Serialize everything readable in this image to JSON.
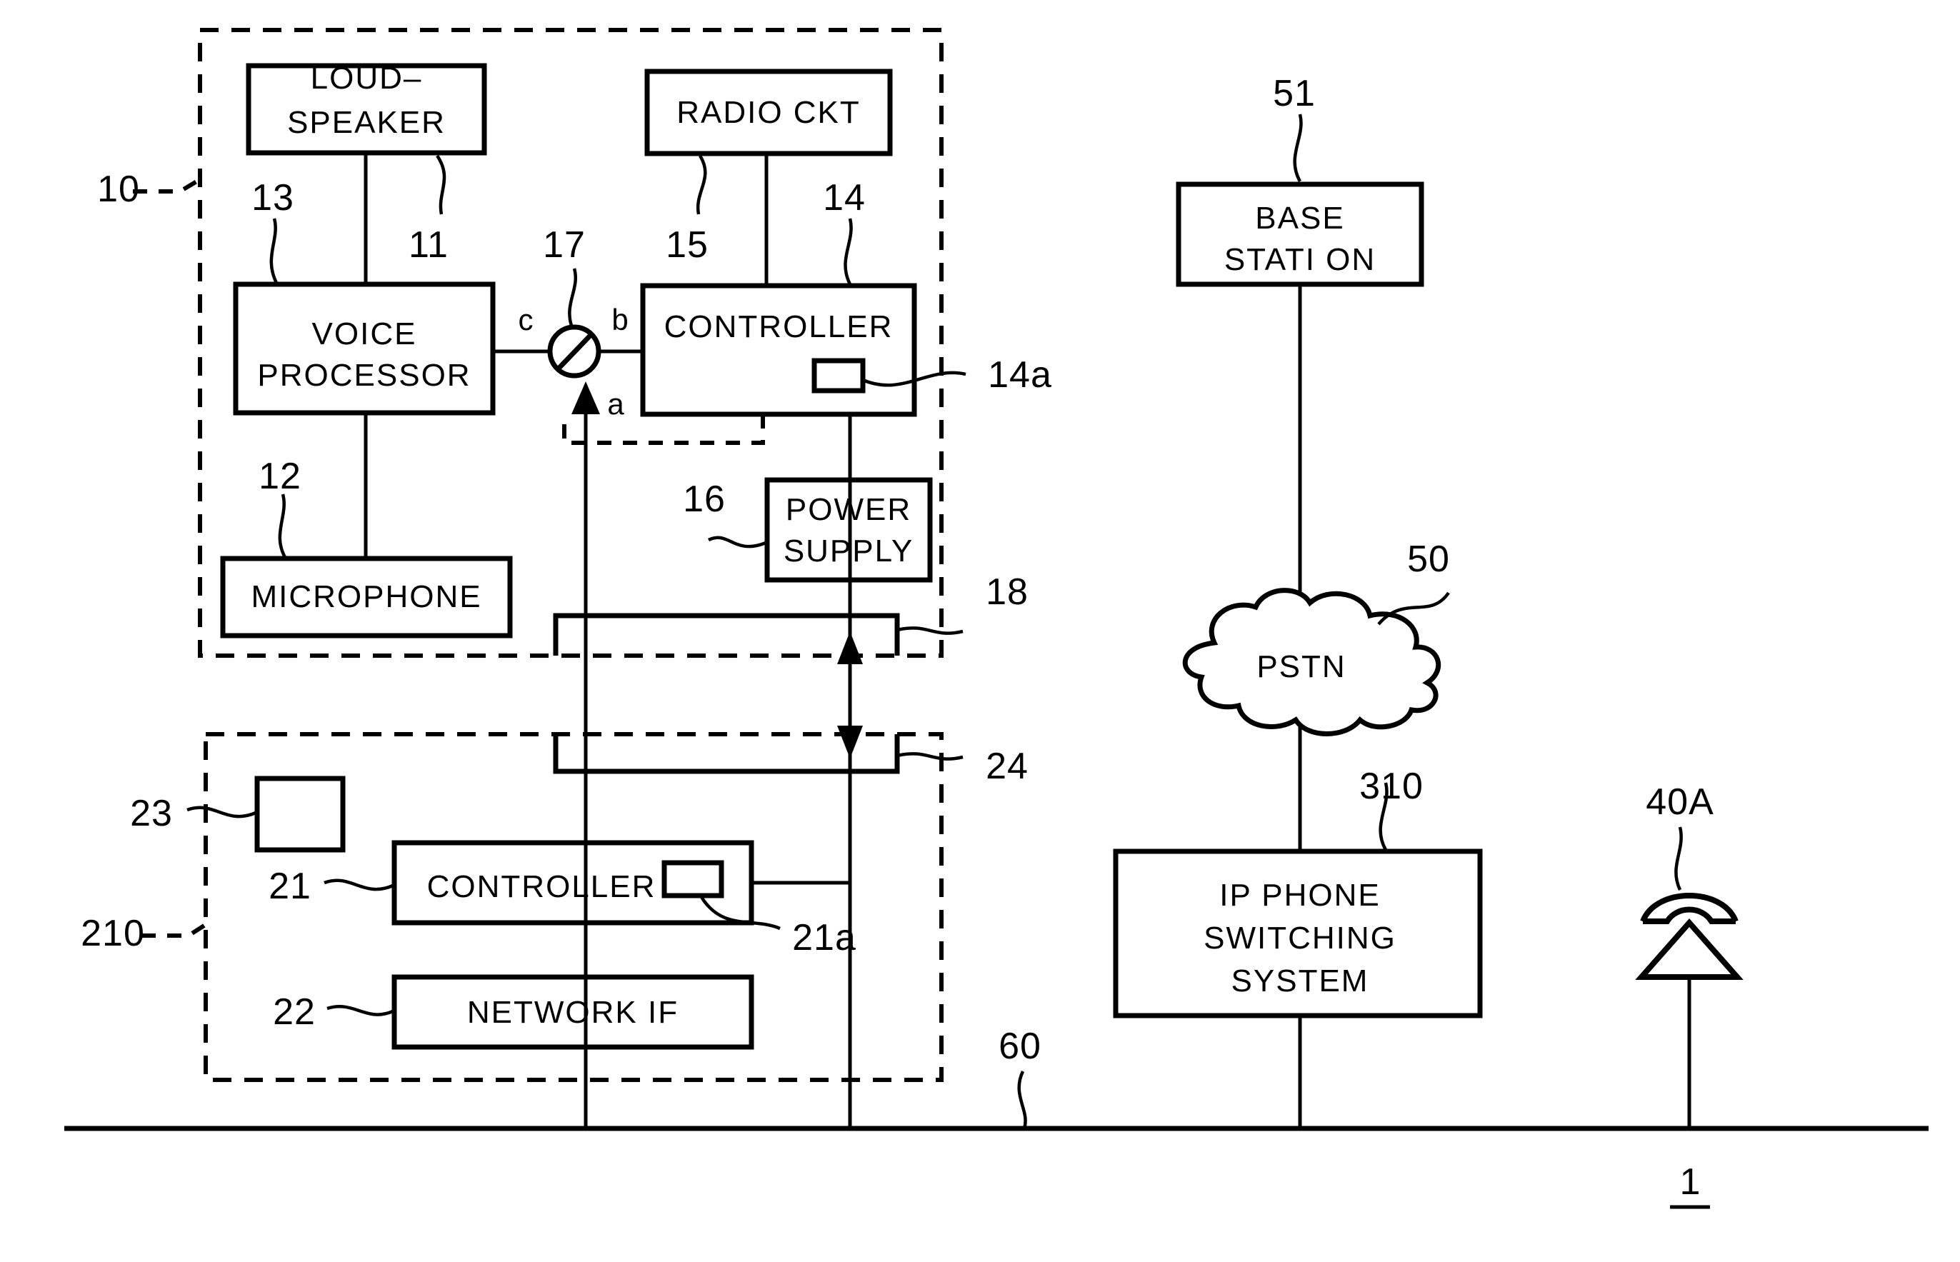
{
  "figure": {
    "title": "Telephone system block diagram",
    "line_color": "#000000",
    "background": "#ffffff"
  },
  "blocks": {
    "loudspeaker": {
      "line1": "LOUD–",
      "line2": "SPEAKER",
      "ref": "11"
    },
    "voice_processor": {
      "line1": "VOICE",
      "line2": "PROCESSOR",
      "ref": "13"
    },
    "microphone": {
      "line1": "MICROPHONE",
      "ref": "12"
    },
    "radio_ckt": {
      "line1": "RADIO CKT",
      "ref": "15"
    },
    "controller_top": {
      "line1": "CONTROLLER",
      "ref": "14",
      "sub_ref": "14a"
    },
    "power_supply": {
      "line1": "POWER",
      "line2": "SUPPLY",
      "ref": "16"
    },
    "controller_bottom": {
      "line1": "CONTROLLER",
      "ref": "21",
      "sub_ref": "21a"
    },
    "network_if": {
      "line1": "NETWORK IF",
      "ref": "22"
    },
    "base_station": {
      "line1": "BASE",
      "line2": "STATI ON",
      "ref": "51"
    },
    "pstn": {
      "line1": "PSTN",
      "ref": "50"
    },
    "ip_switching": {
      "line1": "IP PHONE",
      "line2": "SWITCHING",
      "line3": "SYSTEM",
      "ref": "310"
    },
    "small_box_23": {
      "ref": "23"
    },
    "telephone_40a": {
      "ref": "40A"
    }
  },
  "switch": {
    "ref": "17",
    "terminal_c": "c",
    "terminal_b": "b",
    "terminal_a": "a"
  },
  "connectors": {
    "upper": {
      "ref": "18"
    },
    "lower": {
      "ref": "24"
    }
  },
  "enclosures": {
    "handset_unit": {
      "ref": "10"
    },
    "base_unit": {
      "ref": "210"
    }
  },
  "ground_line": {
    "ref": "60"
  },
  "figure_number": "1"
}
